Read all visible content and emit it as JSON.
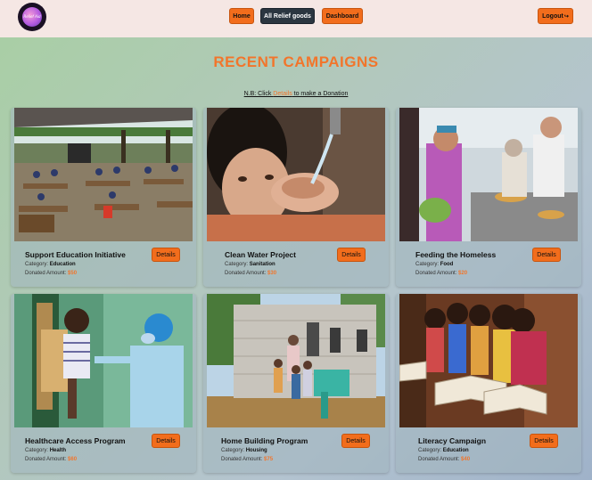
{
  "nav": {
    "logo_text": "Relief Aid",
    "home": "Home",
    "relief_goods": "All Relief goods",
    "dashboard": "Dashboard",
    "logout": "Logout"
  },
  "page": {
    "title": "RECENT CAMPAIGNS",
    "note_prefix": "N.B: Click ",
    "note_link": "Details",
    "note_suffix": " to make a Donation"
  },
  "labels": {
    "category": "Category: ",
    "donated": "Donated Amount: ",
    "details": "Details"
  },
  "campaigns": [
    {
      "title": "Support Education Initiative",
      "category": "Education",
      "amount": "$50"
    },
    {
      "title": "Clean Water Project",
      "category": "Sanitation",
      "amount": "$30"
    },
    {
      "title": "Feeding the Homeless",
      "category": "Food",
      "amount": "$20"
    },
    {
      "title": "Healthcare Access Program",
      "category": "Health",
      "amount": "$60"
    },
    {
      "title": "Home Building Program",
      "category": "Housing",
      "amount": "$75"
    },
    {
      "title": "Literacy Campaign",
      "category": "Education",
      "amount": "$40"
    }
  ],
  "colors": {
    "accent": "#f26d1c",
    "title": "#f2752b",
    "nav_active": "#2b3640"
  }
}
